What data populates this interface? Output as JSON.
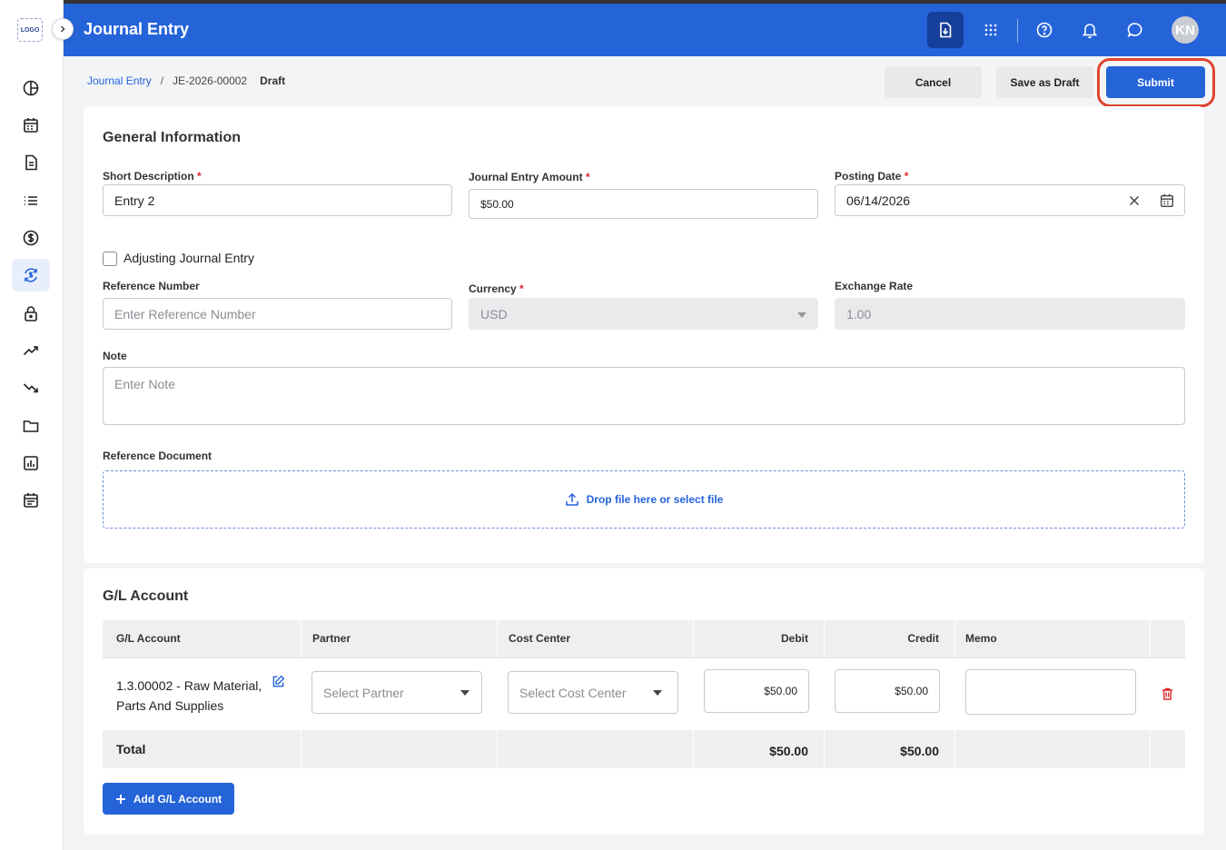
{
  "app": {
    "logo_text": "LOGO",
    "title": "Journal Entry",
    "avatar_initials": "KN"
  },
  "sidebar": {
    "items": [
      {
        "icon": "pie-chart-icon"
      },
      {
        "icon": "calendar-icon"
      },
      {
        "icon": "document-icon"
      },
      {
        "icon": "list-icon"
      },
      {
        "icon": "dollar-icon"
      },
      {
        "icon": "exchange-icon",
        "active": true
      },
      {
        "icon": "lock-icon"
      },
      {
        "icon": "trending-up-icon"
      },
      {
        "icon": "trending-down-icon"
      },
      {
        "icon": "folder-icon"
      },
      {
        "icon": "report-icon"
      },
      {
        "icon": "schedule-icon"
      }
    ]
  },
  "breadcrumb": {
    "root": "Journal Entry",
    "separator": "/",
    "id": "JE-2026-00002",
    "status": "Draft"
  },
  "actions": {
    "cancel": "Cancel",
    "save_draft": "Save as Draft",
    "submit": "Submit"
  },
  "general": {
    "title": "General Information",
    "short_description": {
      "label": "Short Description",
      "value": "Entry 2"
    },
    "amount": {
      "label": "Journal Entry Amount",
      "value": "$50.00"
    },
    "posting_date": {
      "label": "Posting Date",
      "value": "06/14/2026"
    },
    "adjusting": {
      "label": "Adjusting Journal Entry"
    },
    "reference_number": {
      "label": "Reference Number",
      "placeholder": "Enter Reference Number"
    },
    "currency": {
      "label": "Currency",
      "value": "USD"
    },
    "exchange_rate": {
      "label": "Exchange Rate",
      "value": "1.00"
    },
    "note": {
      "label": "Note",
      "placeholder": "Enter Note"
    },
    "reference_document": {
      "label": "Reference Document",
      "dropzone": "Drop file here or select file"
    },
    "required_mark": "*"
  },
  "gl": {
    "title": "G/L Account",
    "columns": {
      "account": "G/L Account",
      "partner": "Partner",
      "cost_center": "Cost Center",
      "debit": "Debit",
      "credit": "Credit",
      "memo": "Memo"
    },
    "row": {
      "account_line1": "1.3.00002 - Raw Material,",
      "account_line2": "Parts And Supplies",
      "partner_placeholder": "Select Partner",
      "cost_center_placeholder": "Select Cost Center",
      "debit": "$50.00",
      "credit": "$50.00",
      "memo": ""
    },
    "total": {
      "label": "Total",
      "debit": "$50.00",
      "credit": "$50.00"
    },
    "add_button": "Add G/L Account"
  },
  "colors": {
    "primary": "#2563d9",
    "highlight": "#e0432e",
    "danger": "#e02424"
  }
}
